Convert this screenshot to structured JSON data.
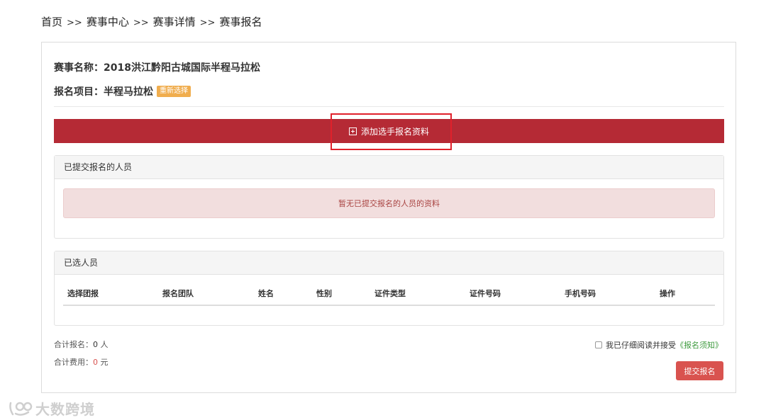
{
  "breadcrumb": {
    "items": [
      "首页",
      "赛事中心",
      "赛事详情",
      "赛事报名"
    ],
    "separator": ">>"
  },
  "event": {
    "name_label": "赛事名称：",
    "name_value": "2018洪江黔阳古城国际半程马拉松",
    "project_label": "报名项目：",
    "project_value": "半程马拉松",
    "reselect_label": "重新选择"
  },
  "add_button": {
    "label": "添加选手报名资料",
    "icon": "plus-square-icon"
  },
  "submitted_panel": {
    "title": "已提交报名的人员",
    "empty_message": "暂无已提交报名的人员的资料"
  },
  "selected_panel": {
    "title": "已选人员",
    "columns": [
      "选择团报",
      "报名团队",
      "姓名",
      "性别",
      "证件类型",
      "证件号码",
      "手机号码",
      "操作"
    ]
  },
  "totals": {
    "count_label": "合计报名：",
    "count_value": "0",
    "count_unit": "人",
    "fee_label": "合计费用：",
    "fee_value": "0",
    "fee_unit": "元"
  },
  "agreement": {
    "text": "我已仔细阅读并接受",
    "link": "《报名须知》",
    "checked": false
  },
  "submit_label": "提交报名",
  "watermark": {
    "text": "大数跨境"
  },
  "colors": {
    "accent_red": "#b52a35",
    "submit_red": "#d9534f",
    "badge_orange": "#f0ad4e",
    "alert_bg": "#f2dede",
    "link_green": "#3c9a3c",
    "highlight_box": "#e0212b"
  }
}
